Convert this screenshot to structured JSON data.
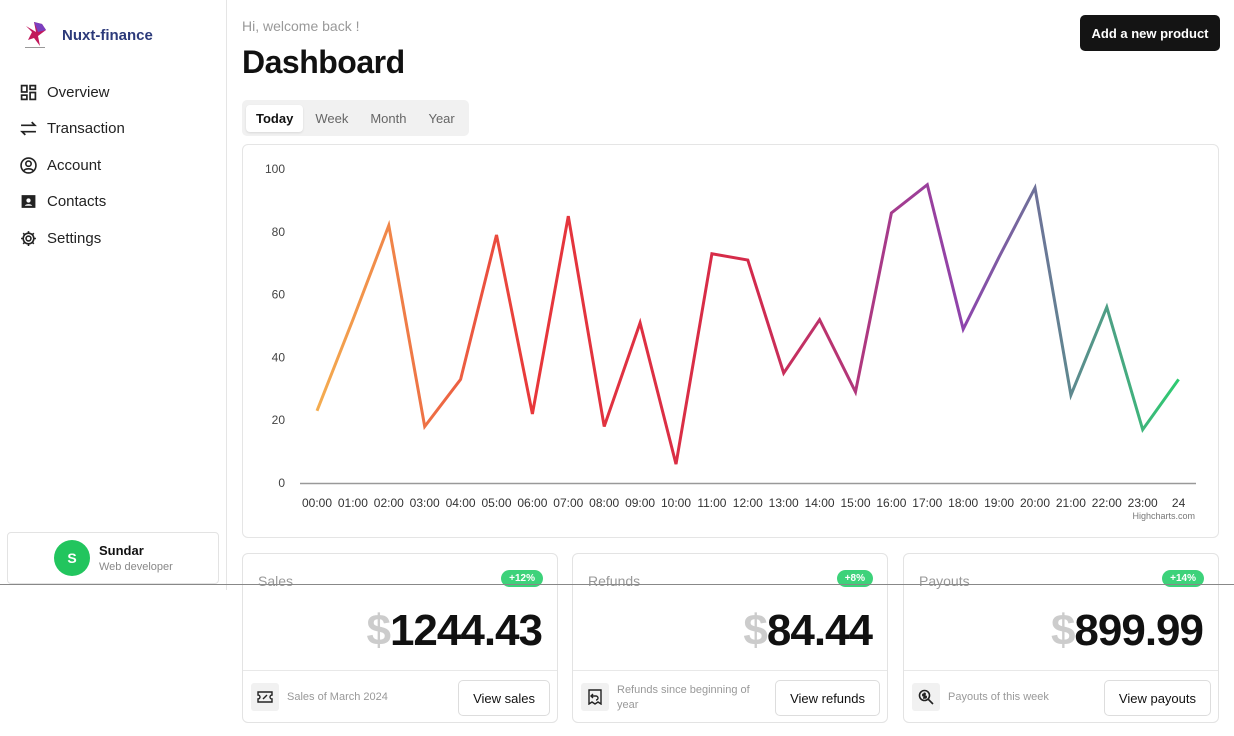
{
  "brand": {
    "name": "Nuxt-finance"
  },
  "sidebar": {
    "items": [
      {
        "label": "Overview",
        "icon": "grid-icon"
      },
      {
        "label": "Transaction",
        "icon": "arrows-swap-icon"
      },
      {
        "label": "Account",
        "icon": "user-circle-icon"
      },
      {
        "label": "Contacts",
        "icon": "contact-card-icon"
      },
      {
        "label": "Settings",
        "icon": "gear-icon"
      }
    ]
  },
  "user": {
    "initial": "S",
    "name": "Sundar",
    "role": "Web developer"
  },
  "header": {
    "welcome": "Hi, welcome back !",
    "title": "Dashboard",
    "add_button": "Add a new product"
  },
  "tabs": [
    {
      "label": "Today",
      "active": true
    },
    {
      "label": "Week"
    },
    {
      "label": "Month"
    },
    {
      "label": "Year"
    }
  ],
  "chart_data": {
    "type": "line",
    "categories": [
      "00:00",
      "01:00",
      "02:00",
      "03:00",
      "04:00",
      "05:00",
      "06:00",
      "07:00",
      "08:00",
      "09:00",
      "10:00",
      "11:00",
      "12:00",
      "13:00",
      "14:00",
      "15:00",
      "16:00",
      "17:00",
      "18:00",
      "19:00",
      "20:00",
      "21:00",
      "22:00",
      "23:00",
      "24"
    ],
    "values": [
      23,
      52,
      82,
      18,
      33,
      79,
      22,
      85,
      18,
      51,
      6,
      73,
      71,
      35,
      52,
      29,
      86,
      95,
      49,
      72,
      94,
      28,
      56,
      17,
      33
    ],
    "yticks": [
      0,
      20,
      40,
      60,
      80,
      100
    ],
    "ylim": [
      0,
      100
    ],
    "gradient": [
      "#f4ad50",
      "#e8373a",
      "#d42a4a",
      "#8e44ad",
      "#2ecc71"
    ],
    "credits": "Highcharts.com",
    "grid": false
  },
  "cards": [
    {
      "label": "Sales",
      "badge": "+12%",
      "currency": "$",
      "amount": "1244.43",
      "foot": "Sales of March 2024",
      "button": "View sales",
      "icon": "ticket-percent-icon"
    },
    {
      "label": "Refunds",
      "badge": "+8%",
      "currency": "$",
      "amount": "84.44",
      "foot": "Refunds since beginning of year",
      "button": "View refunds",
      "icon": "receipt-refund-icon"
    },
    {
      "label": "Payouts",
      "badge": "+14%",
      "currency": "$",
      "amount": "899.99",
      "foot": "Payouts of this week",
      "button": "View payouts",
      "icon": "search-dollar-icon"
    }
  ]
}
